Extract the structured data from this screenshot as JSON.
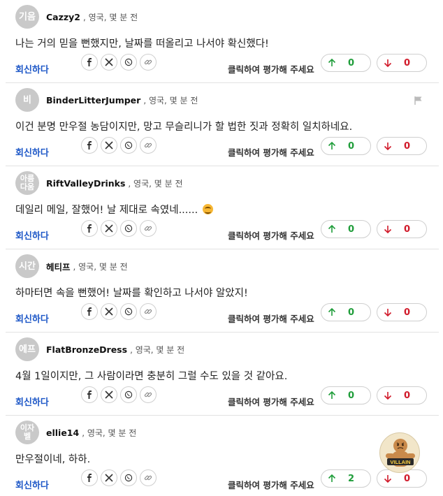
{
  "common": {
    "meta_suffix": ", 영국, 몇 분 전",
    "reply_label": "회신하다",
    "rate_label": "클릭하여 평가해 주세요"
  },
  "badge": {
    "label": "VILLAIN"
  },
  "colors": {
    "link_blue": "#1d57c7",
    "up_green": "#1f9d3a",
    "down_red": "#d11a2a",
    "avatar_gray": "#c9c9c9"
  },
  "comments": [
    {
      "avatar": "기음",
      "username": "Cazzy2",
      "text": "나는 거의 믿을 뻔했지만, 날짜를 떠올리고 나서야 확신했다!",
      "up": "0",
      "down": "0"
    },
    {
      "avatar": "비",
      "username": "BinderLitterJumper",
      "text": "이건 분명 만우절 농담이지만, 망고 무슬리니가 할 법한 짓과 정확히 일치하네요.",
      "up": "0",
      "down": "0"
    },
    {
      "avatar": "아름 다움",
      "username": "RiftValleyDrinks",
      "text": "데일리 메일, 잘했어! 날 제대로 속였네......",
      "up": "0",
      "down": "0"
    },
    {
      "avatar": "시간",
      "username": "헤티프",
      "text": "하마터면 속을 뻔했어! 날짜를 확인하고 나서야 알았지!",
      "up": "0",
      "down": "0"
    },
    {
      "avatar": "에프",
      "username": "FlatBronzeDress",
      "text": "4월 1일이지만, 그 사람이라면 충분히 그럴 수도 있을 것 같아요.",
      "up": "0",
      "down": "0"
    },
    {
      "avatar": "이자 벨",
      "username": "ellie14",
      "text": "만우절이네, 하하.",
      "up": "2",
      "down": "0"
    }
  ]
}
